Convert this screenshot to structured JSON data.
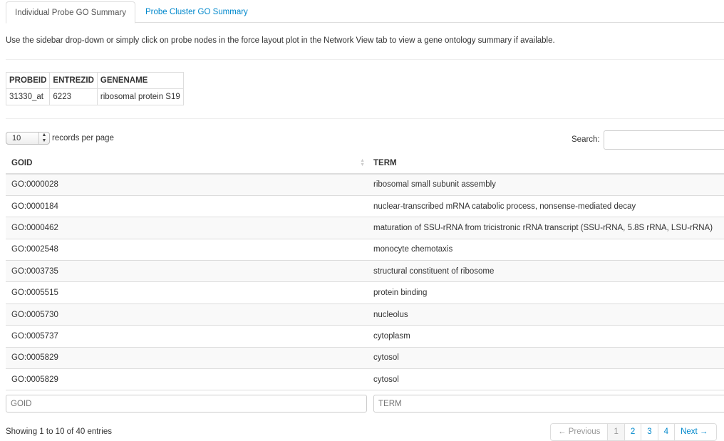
{
  "tabs": [
    {
      "label": "Individual Probe GO Summary",
      "active": true
    },
    {
      "label": "Probe Cluster GO Summary",
      "active": false
    }
  ],
  "intro": "Use the sidebar drop-down or simply click on probe nodes in the force layout plot in the Network View tab to view a gene ontology summary if available.",
  "probe_table": {
    "headers": [
      "PROBEID",
      "ENTREZID",
      "GENENAME"
    ],
    "row": [
      "31330_at",
      "6223",
      "ribosomal protein S19"
    ]
  },
  "length": {
    "value": "10",
    "suffix": "records per page"
  },
  "search": {
    "label": "Search:",
    "value": ""
  },
  "table": {
    "headers": [
      "GOID",
      "TERM"
    ],
    "rows": [
      [
        "GO:0000028",
        "ribosomal small subunit assembly"
      ],
      [
        "GO:0000184",
        "nuclear-transcribed mRNA catabolic process, nonsense-mediated decay"
      ],
      [
        "GO:0000462",
        "maturation of SSU-rRNA from tricistronic rRNA transcript (SSU-rRNA, 5.8S rRNA, LSU-rRNA)"
      ],
      [
        "GO:0002548",
        "monocyte chemotaxis"
      ],
      [
        "GO:0003735",
        "structural constituent of ribosome"
      ],
      [
        "GO:0005515",
        "protein binding"
      ],
      [
        "GO:0005730",
        "nucleolus"
      ],
      [
        "GO:0005737",
        "cytoplasm"
      ],
      [
        "GO:0005829",
        "cytosol"
      ],
      [
        "GO:0005829",
        "cytosol"
      ]
    ],
    "filter_placeholders": [
      "GOID",
      "TERM"
    ]
  },
  "info": "Showing 1 to 10 of 40 entries",
  "pagination": {
    "previous": "← Previous",
    "pages": [
      "1",
      "2",
      "3",
      "4"
    ],
    "current": "1",
    "next": "Next →"
  },
  "colors": {
    "link": "#0088cc",
    "border": "#dddddd",
    "stripe": "#f9f9f9"
  }
}
